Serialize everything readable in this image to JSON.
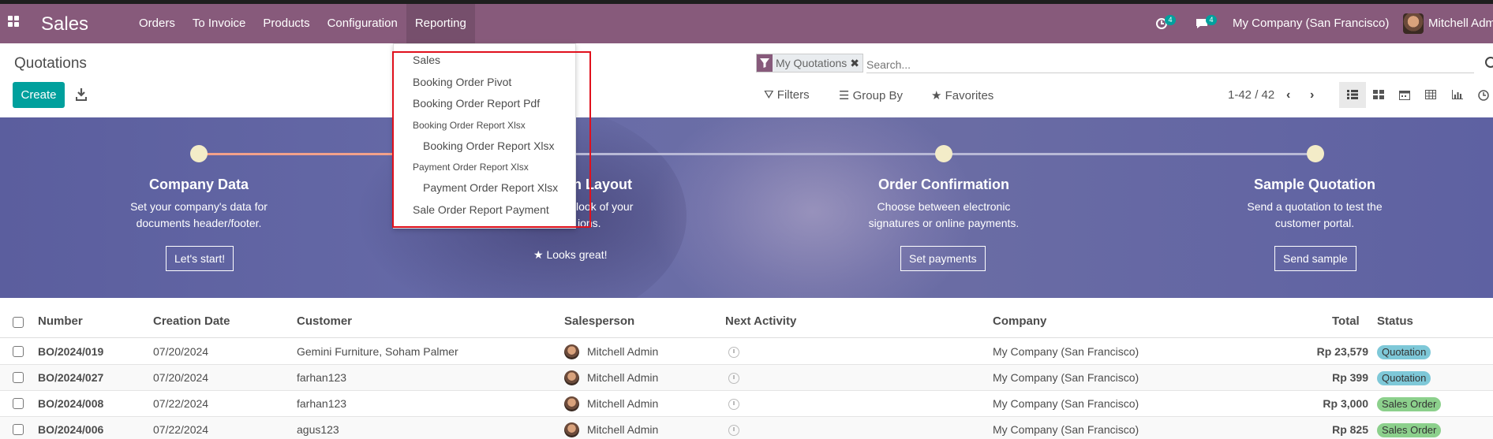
{
  "navbar": {
    "app_name": "Sales",
    "menu": [
      "Orders",
      "To Invoice",
      "Products",
      "Configuration",
      "Reporting"
    ],
    "activity_count": "4",
    "messages_count": "4",
    "company": "My Company (San Francisco)",
    "user": "Mitchell Adm",
    "color": "#875a7b"
  },
  "control_panel": {
    "title": "Quotations",
    "create_label": "Create",
    "facet_label": "My Quotations",
    "search_placeholder": "Search...",
    "filters_label": "Filters",
    "groupby_label": "Group By",
    "favorites_label": "Favorites",
    "pager": "1-42 / 42"
  },
  "reporting_menu": {
    "items": [
      "Sales",
      "Booking Order Pivot",
      "Booking Order Report Pdf",
      "Booking Order Report Xlsx",
      "Booking Order Report Xlsx",
      "Payment Order Report Xlsx",
      "Payment Order Report Xlsx",
      "Sale Order Report Payment"
    ]
  },
  "onboarding": {
    "steps": [
      {
        "title": "Company Data",
        "desc1": "Set your company's data for",
        "desc2": "documents header/footer.",
        "button": "Let's start!"
      },
      {
        "title": "n Layout",
        "desc1": "look of your",
        "desc2": "ions.",
        "done": "Looks great!"
      },
      {
        "title": "Order Confirmation",
        "desc1": "Choose between electronic",
        "desc2": "signatures or online payments.",
        "button": "Set payments"
      },
      {
        "title": "Sample Quotation",
        "desc1": "Send a quotation to test the",
        "desc2": "customer portal.",
        "button": "Send sample"
      }
    ]
  },
  "table": {
    "headers": {
      "number": "Number",
      "creation_date": "Creation Date",
      "customer": "Customer",
      "salesperson": "Salesperson",
      "next_activity": "Next Activity",
      "company": "Company",
      "total": "Total",
      "status": "Status"
    },
    "rows": [
      {
        "number": "BO/2024/019",
        "date": "07/20/2024",
        "customer": "Gemini Furniture, Soham Palmer",
        "salesperson": "Mitchell Admin",
        "company": "My Company (San Francisco)",
        "total": "Rp 23,579",
        "status": "Quotation"
      },
      {
        "number": "BO/2024/027",
        "date": "07/20/2024",
        "customer": "farhan123",
        "salesperson": "Mitchell Admin",
        "company": "My Company (San Francisco)",
        "total": "Rp 399",
        "status": "Quotation"
      },
      {
        "number": "BO/2024/008",
        "date": "07/22/2024",
        "customer": "farhan123",
        "salesperson": "Mitchell Admin",
        "company": "My Company (San Francisco)",
        "total": "Rp 3,000",
        "status": "Sales Order"
      },
      {
        "number": "BO/2024/006",
        "date": "07/22/2024",
        "customer": "agus123",
        "salesperson": "Mitchell Admin",
        "company": "My Company (San Francisco)",
        "total": "Rp 825",
        "status": "Sales Order"
      }
    ],
    "status_colors": {
      "Quotation": "#7ec8d8",
      "Sales Order": "#8cd08c"
    }
  }
}
